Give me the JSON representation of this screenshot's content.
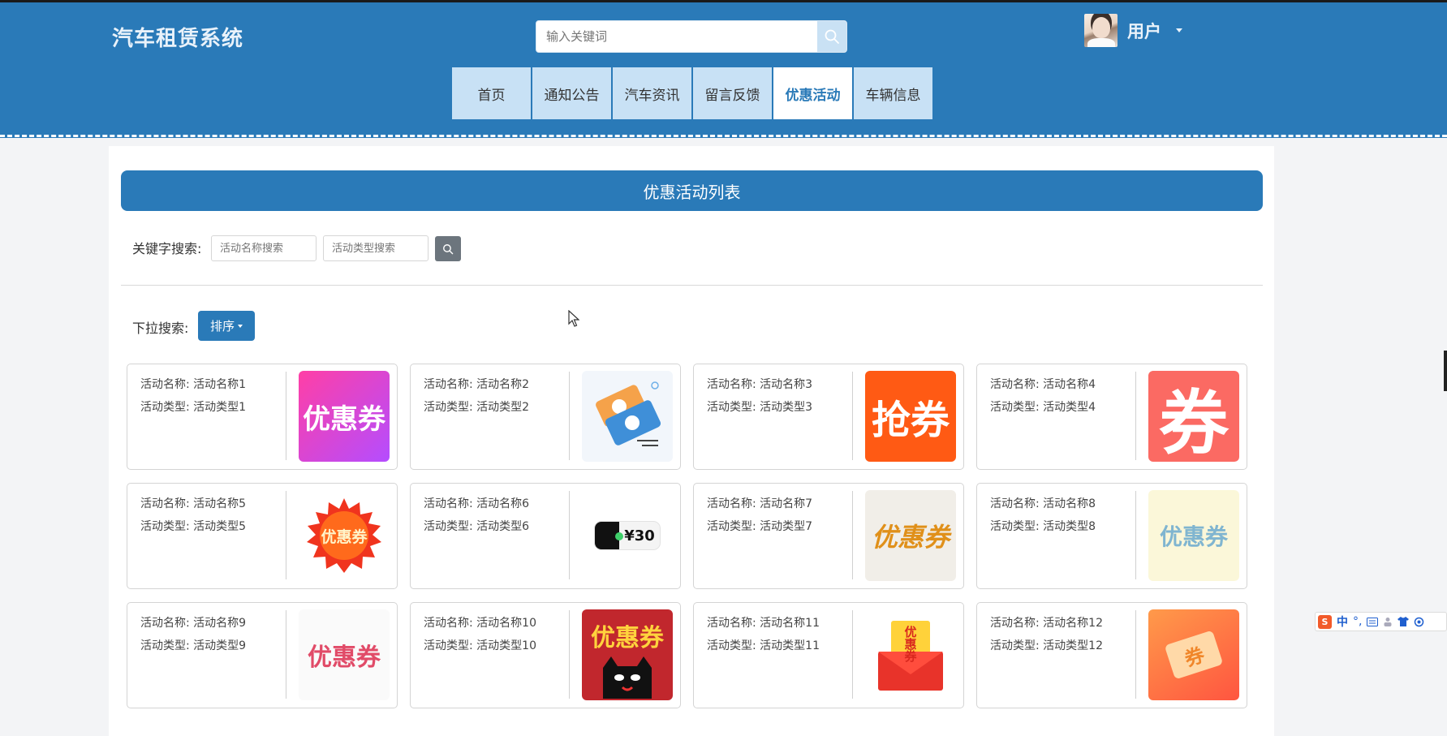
{
  "header": {
    "brand": "汽车租赁系统",
    "search_placeholder": "输入关键词",
    "user_name": "用户",
    "accent_color": "#2a7ab8"
  },
  "nav": {
    "items": [
      {
        "label": "首页"
      },
      {
        "label": "通知公告"
      },
      {
        "label": "汽车资讯"
      },
      {
        "label": "留言反馈"
      },
      {
        "label": "优惠活动",
        "active": true
      },
      {
        "label": "车辆信息"
      }
    ]
  },
  "main": {
    "title": "优惠活动列表",
    "keyword_label": "关键字搜索:",
    "name_search_placeholder": "活动名称搜索",
    "type_search_placeholder": "活动类型搜索",
    "dropdown_label": "下拉搜索:",
    "sort_label": "排序"
  },
  "cards": [
    {
      "name": "活动名称: 活动名称1",
      "type": "活动类型: 活动类型1",
      "image_text": "优惠券"
    },
    {
      "name": "活动名称: 活动名称2",
      "type": "活动类型: 活动类型2"
    },
    {
      "name": "活动名称: 活动名称3",
      "type": "活动类型: 活动类型3",
      "image_text": "抢券"
    },
    {
      "name": "活动名称: 活动名称4",
      "type": "活动类型: 活动类型4",
      "image_text": "券"
    },
    {
      "name": "活动名称: 活动名称5",
      "type": "活动类型: 活动类型5",
      "image_text": "优惠券"
    },
    {
      "name": "活动名称: 活动名称6",
      "type": "活动类型: 活动类型6",
      "image_text": "¥30"
    },
    {
      "name": "活动名称: 活动名称7",
      "type": "活动类型: 活动类型7",
      "image_text": "优惠券"
    },
    {
      "name": "活动名称: 活动名称8",
      "type": "活动类型: 活动类型8",
      "image_text": "优惠券"
    },
    {
      "name": "活动名称: 活动名称9",
      "type": "活动类型: 活动类型9",
      "image_text": "优惠券"
    },
    {
      "name": "活动名称: 活动名称10",
      "type": "活动类型: 活动类型10",
      "image_text": "优惠券"
    },
    {
      "name": "活动名称: 活动名称11",
      "type": "活动类型: 活动类型11",
      "image_text": "优惠券"
    },
    {
      "name": "活动名称: 活动名称12",
      "type": "活动类型: 活动类型12",
      "image_text": "券"
    }
  ],
  "ime_toolbar": {
    "logo": "S",
    "mode": "中"
  }
}
